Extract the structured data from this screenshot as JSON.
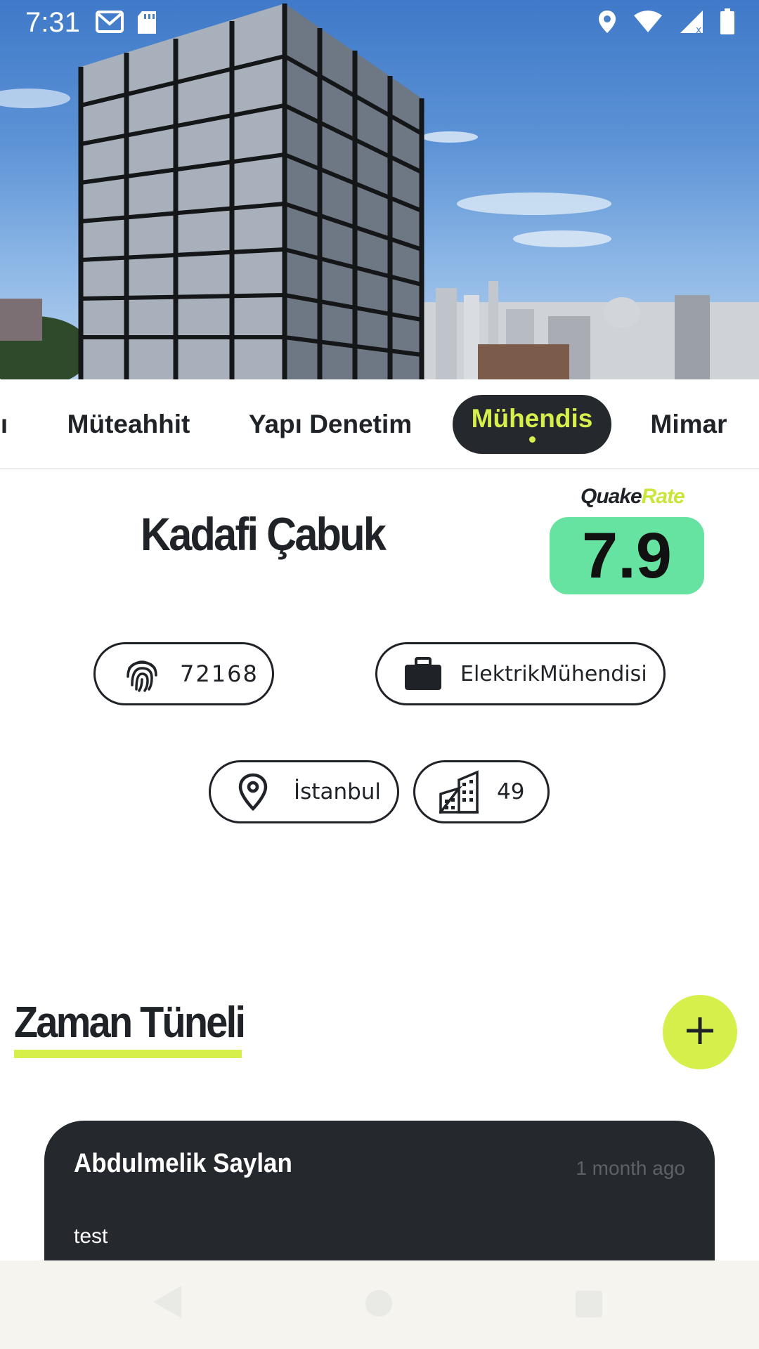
{
  "status_bar": {
    "time": "7:31",
    "left_icons": [
      "gmail-icon",
      "sd-card-icon"
    ],
    "right_icons": [
      "location-icon",
      "wifi-icon",
      "signal-icon",
      "battery-icon"
    ]
  },
  "hero": {
    "image": "building-photo"
  },
  "tabs": {
    "items": [
      {
        "label": "ı"
      },
      {
        "label": "Müteahhit"
      },
      {
        "label": "Yapı Denetim"
      },
      {
        "label": "Mühendis",
        "active": true
      },
      {
        "label": "Mimar"
      }
    ]
  },
  "profile": {
    "name": "Kadafi Çabuk",
    "rating_brand_quake": "Quake",
    "rating_brand_rate": "Rate",
    "rating": "7.9",
    "id_number": "72168",
    "profession": "ElektrikMühendisi",
    "city": "İstanbul",
    "building_count": "49"
  },
  "timeline": {
    "title": "Zaman Tüneli",
    "add_icon": "plus-icon",
    "entries": [
      {
        "author": "Abdulmelik Saylan",
        "time": "1 month ago",
        "text": "test"
      }
    ]
  },
  "nav": {
    "icons": [
      "back-icon",
      "home-icon",
      "recents-icon"
    ]
  },
  "colors": {
    "accent": "#d7ef4a",
    "dark": "#25292e",
    "rating_bg": "#66e3a1",
    "nav_bg": "#f5f4ef"
  }
}
